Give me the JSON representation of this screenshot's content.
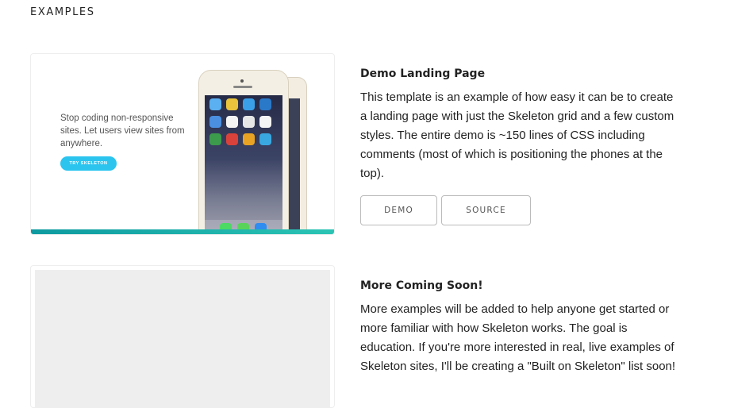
{
  "section": {
    "title": "EXAMPLES"
  },
  "examples": [
    {
      "title": "Demo Landing Page",
      "description": "This template is an example of how easy it can be to create a landing page with just the Skeleton grid and a few custom styles. The entire demo is ~150 lines of CSS including comments (most of which is positioning the phones at the top).",
      "thumbnail": {
        "headline": "Stop coding non-responsive sites. Let users view sites from anywhere.",
        "button_label": "TRY SKELETON"
      },
      "buttons": [
        {
          "label": "DEMO"
        },
        {
          "label": "SOURCE"
        }
      ]
    },
    {
      "title": "More Coming Soon!",
      "description": "More examples will be added to help anyone get started or more familiar with how Skeleton works. The goal is education. If you're more interested in real, live examples of Skeleton sites, I'll be creating a \"Built on Skeleton\" list soon!"
    }
  ],
  "colors": {
    "accent": "#2bc4ef",
    "teal": "#0e9aa0",
    "placeholder": "#eeeeee"
  }
}
